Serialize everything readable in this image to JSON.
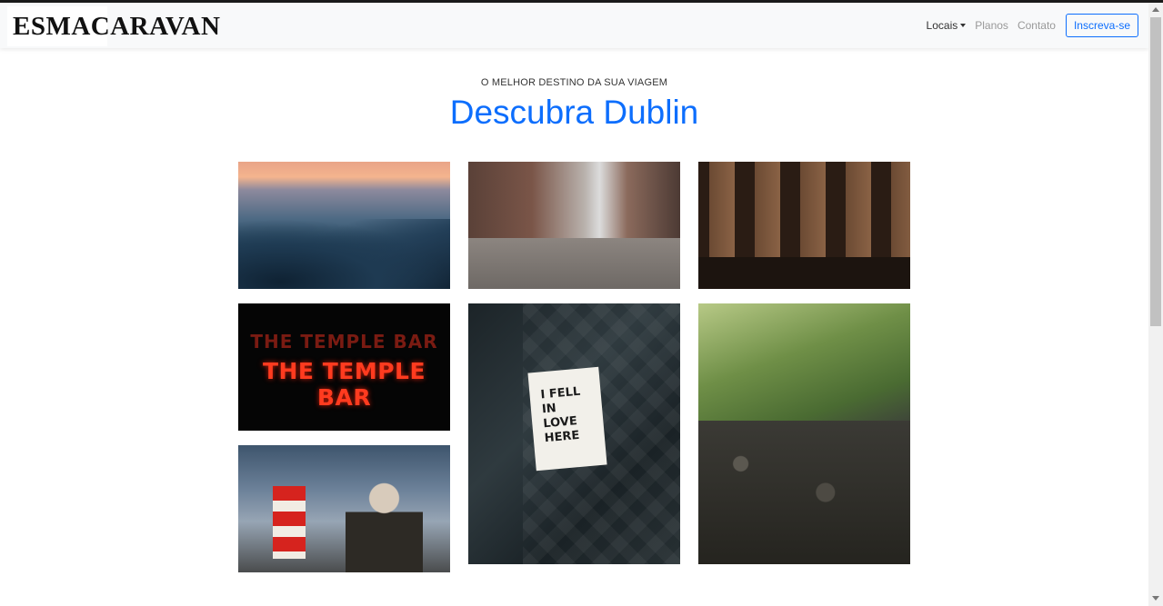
{
  "navbar": {
    "brand": "ESMACARAVAN",
    "links": [
      {
        "label": "Locais"
      },
      {
        "label": "Planos"
      },
      {
        "label": "Contato"
      }
    ],
    "cta_label": "Inscreva-se"
  },
  "hero": {
    "eyebrow": "O MELHOR DESTINO DA SUA VIAGEM",
    "title": "Descubra Dublin"
  },
  "gallery": {
    "temple_bar": {
      "neon_top": "THE TEMPLE BAR",
      "neon_main": "THE TEMPLE BAR"
    },
    "sign": {
      "text": "I FELL\nIN\nLOVE\nHERE"
    }
  },
  "colors": {
    "accent": "#0d6efd",
    "navbar_bg": "#f8f9fa"
  },
  "icons": {
    "dropdown": "caret-down-icon"
  }
}
